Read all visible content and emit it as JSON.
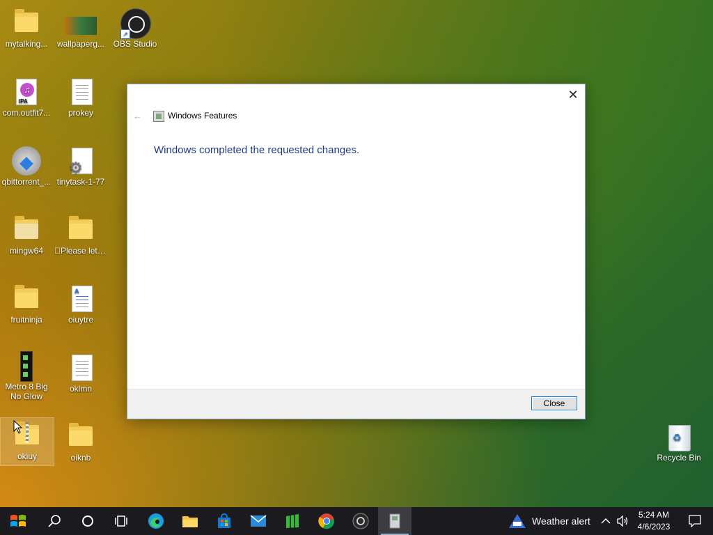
{
  "desktop": {
    "icons": [
      {
        "label": "mytalking...",
        "type": "folder"
      },
      {
        "label": "wallpaperg...",
        "type": "image"
      },
      {
        "label": "OBS Studio",
        "type": "obs"
      },
      {
        "label": "com.outfit7...",
        "type": "ipa"
      },
      {
        "label": "prokey",
        "type": "doc"
      },
      {
        "label": "qbittorrent_...",
        "type": "installer"
      },
      {
        "label": "tinytask-1-77",
        "type": "settings-doc"
      },
      {
        "label": "mingw64",
        "type": "folder"
      },
      {
        "label": "\u0000Please let me",
        "type": "folder"
      },
      {
        "label": "fruitninja",
        "type": "folder"
      },
      {
        "label": "oiuytre",
        "type": "word-doc"
      },
      {
        "label": "Metro 8 Big No Glow",
        "type": "theme"
      },
      {
        "label": "oklmn",
        "type": "doc"
      },
      {
        "label": "okiuy",
        "type": "zip-folder"
      },
      {
        "label": "oiknb",
        "type": "folder"
      },
      {
        "label": "Recycle Bin",
        "type": "recycle-bin"
      }
    ]
  },
  "dialog": {
    "title": "Windows Features",
    "message": "Windows completed the requested changes.",
    "close_button": "Close",
    "close_glyph": "✕",
    "back_glyph": "←"
  },
  "taskbar": {
    "weather_label": "Weather alert",
    "time": "5:24 AM",
    "date": "4/6/2023",
    "pinned": [
      "start-icon",
      "search-icon",
      "cortana-icon",
      "task-view-icon",
      "edge-icon",
      "file-explorer-icon",
      "store-icon",
      "mail-icon",
      "green-app-icon",
      "chrome-icon",
      "obs-icon",
      "windows-features-icon"
    ]
  }
}
